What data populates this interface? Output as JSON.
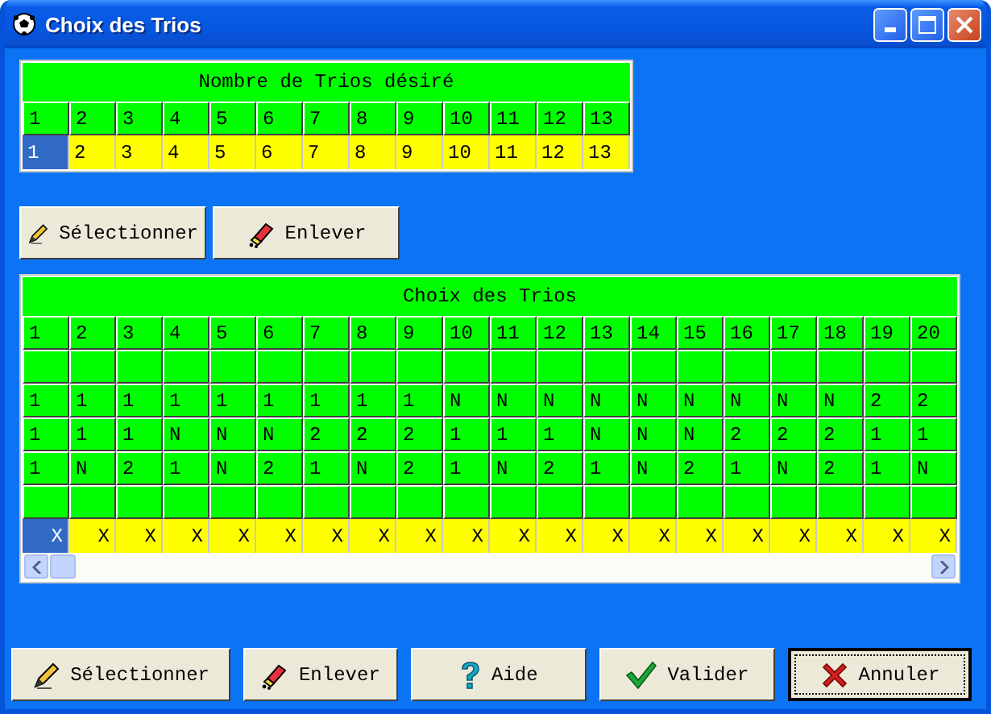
{
  "window": {
    "title": "Choix des Trios"
  },
  "count_table": {
    "title": "Nombre de Trios désiré",
    "columns": [
      "1",
      "2",
      "3",
      "4",
      "5",
      "6",
      "7",
      "8",
      "9",
      "10",
      "11",
      "12",
      "13"
    ],
    "values": [
      {
        "text": "1",
        "selected": true
      },
      {
        "text": "2",
        "selected": false
      },
      {
        "text": "3",
        "selected": false
      },
      {
        "text": "4",
        "selected": false
      },
      {
        "text": "5",
        "selected": false
      },
      {
        "text": "6",
        "selected": false
      },
      {
        "text": "7",
        "selected": false
      },
      {
        "text": "8",
        "selected": false
      },
      {
        "text": "9",
        "selected": false
      },
      {
        "text": "10",
        "selected": false
      },
      {
        "text": "11",
        "selected": false
      },
      {
        "text": "12",
        "selected": false
      },
      {
        "text": "13",
        "selected": false
      }
    ]
  },
  "top_buttons": [
    {
      "label": "Sélectionner",
      "kind": "pencil"
    },
    {
      "label": "Enlever",
      "kind": "eraser"
    }
  ],
  "trios_table": {
    "title": "Choix des Trios",
    "columns": [
      "1",
      "2",
      "3",
      "4",
      "5",
      "6",
      "7",
      "8",
      "9",
      "10",
      "11",
      "12",
      "13",
      "14",
      "15",
      "16",
      "17",
      "18",
      "19",
      "20"
    ],
    "rows": [
      {
        "kind": "blank"
      },
      {
        "kind": "values",
        "cells": [
          "1",
          "1",
          "1",
          "1",
          "1",
          "1",
          "1",
          "1",
          "1",
          "N",
          "N",
          "N",
          "N",
          "N",
          "N",
          "N",
          "N",
          "N",
          "2",
          "2"
        ]
      },
      {
        "kind": "values",
        "cells": [
          "1",
          "1",
          "1",
          "N",
          "N",
          "N",
          "2",
          "2",
          "2",
          "1",
          "1",
          "1",
          "N",
          "N",
          "N",
          "2",
          "2",
          "2",
          "1",
          "1"
        ]
      },
      {
        "kind": "values",
        "cells": [
          "1",
          "N",
          "2",
          "1",
          "N",
          "2",
          "1",
          "N",
          "2",
          "1",
          "N",
          "2",
          "1",
          "N",
          "2",
          "1",
          "N",
          "2",
          "1",
          "N"
        ]
      },
      {
        "kind": "blank"
      }
    ],
    "marks": [
      {
        "text": "X",
        "selected": true
      },
      {
        "text": "X",
        "selected": false
      },
      {
        "text": "X",
        "selected": false
      },
      {
        "text": "X",
        "selected": false
      },
      {
        "text": "X",
        "selected": false
      },
      {
        "text": "X",
        "selected": false
      },
      {
        "text": "X",
        "selected": false
      },
      {
        "text": "X",
        "selected": false
      },
      {
        "text": "X",
        "selected": false
      },
      {
        "text": "X",
        "selected": false
      },
      {
        "text": "X",
        "selected": false
      },
      {
        "text": "X",
        "selected": false
      },
      {
        "text": "X",
        "selected": false
      },
      {
        "text": "X",
        "selected": false
      },
      {
        "text": "X",
        "selected": false
      },
      {
        "text": "X",
        "selected": false
      },
      {
        "text": "X",
        "selected": false
      },
      {
        "text": "X",
        "selected": false
      },
      {
        "text": "X",
        "selected": false
      },
      {
        "text": "X",
        "selected": false
      }
    ]
  },
  "bottom_buttons": [
    {
      "label": "Sélectionner",
      "kind": "pencil",
      "focused": false
    },
    {
      "label": "Enlever",
      "kind": "eraser",
      "focused": false
    },
    {
      "label": "Aide",
      "kind": "help",
      "focused": false
    },
    {
      "label": "Valider",
      "kind": "check",
      "focused": false
    },
    {
      "label": "Annuler",
      "kind": "cross",
      "focused": true
    }
  ]
}
